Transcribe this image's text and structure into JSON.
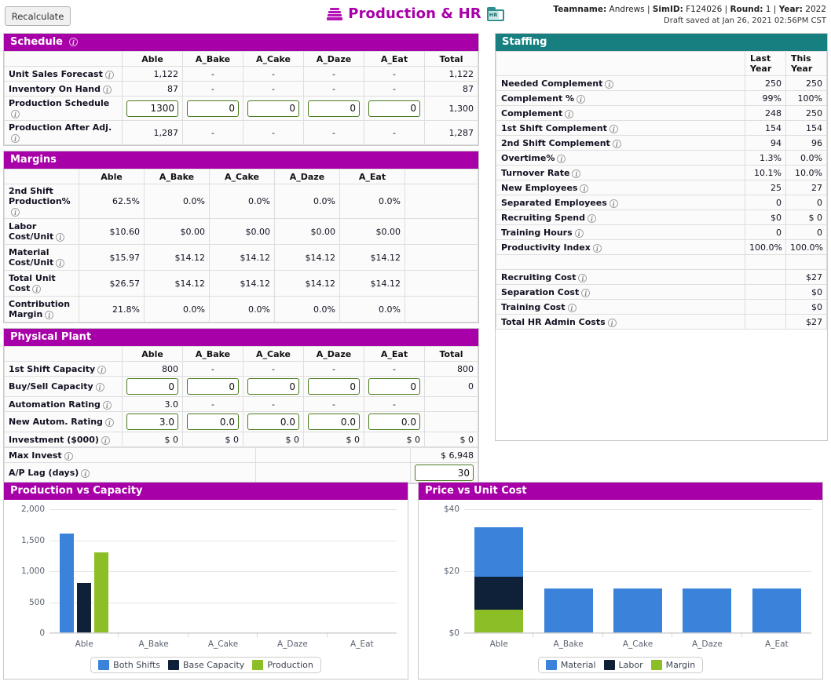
{
  "toolbar": {
    "recalculate_label": "Recalculate",
    "page_title": "Production & HR",
    "stack_icon": "stack-icon",
    "hr_folder_icon": "hr-folder-icon",
    "hr_folder_label": "HR"
  },
  "header_info": {
    "teamname_label": "Teamname:",
    "teamname_value": "Andrews",
    "simid_label": "SimID:",
    "simid_value": "F124026",
    "round_label": "Round:",
    "round_value": "1",
    "year_label": "Year:",
    "year_value": "2022",
    "draft_saved": "Draft saved at Jan 26, 2021 02:56PM CST"
  },
  "schedule": {
    "title": "Schedule",
    "columns": [
      "",
      "Able",
      "A_Bake",
      "A_Cake",
      "A_Daze",
      "A_Eat",
      "Total"
    ],
    "rows": [
      {
        "label": "Unit Sales Forecast",
        "cells": [
          "1,122",
          "-",
          "-",
          "-",
          "-"
        ],
        "total": "1,122",
        "input": false
      },
      {
        "label": "Inventory On Hand",
        "cells": [
          "87",
          "-",
          "-",
          "-",
          "-"
        ],
        "total": "87",
        "input": false
      },
      {
        "label": "Production Schedule",
        "cells": [
          "1300",
          "0",
          "0",
          "0",
          "0"
        ],
        "total": "1,300",
        "input": true
      },
      {
        "label": "Production After Adj.",
        "cells": [
          "1,287",
          "-",
          "-",
          "-",
          "-"
        ],
        "total": "1,287",
        "input": false
      }
    ]
  },
  "margins": {
    "title": "Margins",
    "columns": [
      "",
      "Able",
      "A_Bake",
      "A_Cake",
      "A_Daze",
      "A_Eat",
      ""
    ],
    "rows": [
      {
        "label": "2nd Shift Production%",
        "cells": [
          "62.5%",
          "0.0%",
          "0.0%",
          "0.0%",
          "0.0%"
        ]
      },
      {
        "label": "Labor Cost/Unit",
        "cells": [
          "$10.60",
          "$0.00",
          "$0.00",
          "$0.00",
          "$0.00"
        ]
      },
      {
        "label": "Material Cost/Unit",
        "cells": [
          "$15.97",
          "$14.12",
          "$14.12",
          "$14.12",
          "$14.12"
        ]
      },
      {
        "label": "Total Unit Cost",
        "cells": [
          "$26.57",
          "$14.12",
          "$14.12",
          "$14.12",
          "$14.12"
        ]
      },
      {
        "label": "Contribution Margin",
        "cells": [
          "21.8%",
          "0.0%",
          "0.0%",
          "0.0%",
          "0.0%"
        ]
      }
    ]
  },
  "physical_plant": {
    "title": "Physical Plant",
    "columns": [
      "",
      "Able",
      "A_Bake",
      "A_Cake",
      "A_Daze",
      "A_Eat",
      "Total"
    ],
    "rows": [
      {
        "label": "1st Shift Capacity",
        "cells": [
          "800",
          "-",
          "-",
          "-",
          "-"
        ],
        "total": "800",
        "input": false
      },
      {
        "label": "Buy/Sell Capacity",
        "cells": [
          "0",
          "0",
          "0",
          "0",
          "0"
        ],
        "total": "0",
        "input": true
      },
      {
        "label": "Automation Rating",
        "cells": [
          "3.0",
          "-",
          "-",
          "-",
          "-"
        ],
        "total": "",
        "input": false
      },
      {
        "label": "New Autom. Rating",
        "cells": [
          "3.0",
          "0.0",
          "0.0",
          "0.0",
          "0.0"
        ],
        "total": "",
        "input": true
      },
      {
        "label": "Investment ($000)",
        "cells": [
          "$ 0",
          "$ 0",
          "$ 0",
          "$ 0",
          "$ 0"
        ],
        "total": "$ 0",
        "input": false
      }
    ],
    "max_invest_label": "Max Invest",
    "max_invest_value": "$ 6,948",
    "ap_lag_label": "A/P Lag (days)",
    "ap_lag_value": "30"
  },
  "staffing": {
    "title": "Staffing",
    "col_last_year": "Last\nYear",
    "col_last_year_l1": "Last",
    "col_last_year_l2": "Year",
    "col_this_year_l1": "This",
    "col_this_year_l2": "Year",
    "rows": [
      {
        "label": "Needed Complement",
        "last": "250",
        "this": "250"
      },
      {
        "label": "Complement %",
        "last": "99%",
        "this": "100%"
      },
      {
        "label": "Complement",
        "last": "248",
        "this": "250"
      },
      {
        "label": "1st Shift Complement",
        "last": "154",
        "this": "154"
      },
      {
        "label": "2nd Shift Complement",
        "last": "94",
        "this": "96"
      },
      {
        "label": "Overtime%",
        "last": "1.3%",
        "this": "0.0%"
      },
      {
        "label": "Turnover Rate",
        "last": "10.1%",
        "this": "10.0%"
      },
      {
        "label": "New Employees",
        "last": "25",
        "this": "27"
      },
      {
        "label": "Separated Employees",
        "last": "0",
        "this": "0"
      },
      {
        "label": "Recruiting Spend",
        "last": "$0",
        "this": "$ 0"
      },
      {
        "label": "Training Hours",
        "last": "0",
        "this": "0"
      },
      {
        "label": "Productivity Index",
        "last": "100.0%",
        "this": "100.0%"
      }
    ],
    "cost_rows": [
      {
        "label": "Recruiting Cost",
        "last": "",
        "this": "$27"
      },
      {
        "label": "Separation Cost",
        "last": "",
        "this": "$0"
      },
      {
        "label": "Training Cost",
        "last": "",
        "this": "$0"
      },
      {
        "label": "Total HR Admin Costs",
        "last": "",
        "this": "$27"
      }
    ]
  },
  "colors": {
    "magenta": "#a800a8",
    "teal": "#177f7f",
    "blue": "#3b82db",
    "navy": "#0f2039",
    "green": "#8cbe26"
  },
  "chart_data": [
    {
      "type": "bar",
      "title": "Production vs Capacity",
      "categories": [
        "Able",
        "A_Bake",
        "A_Cake",
        "A_Daze",
        "A_Eat"
      ],
      "series": [
        {
          "name": "Both Shifts",
          "color": "#3b82db",
          "values": [
            1600,
            0,
            0,
            0,
            0
          ]
        },
        {
          "name": "Base Capacity",
          "color": "#0f2039",
          "values": [
            800,
            0,
            0,
            0,
            0
          ]
        },
        {
          "name": "Production",
          "color": "#8cbe26",
          "values": [
            1287,
            0,
            0,
            0,
            0
          ]
        }
      ],
      "yticks": [
        "2,000",
        "1,500",
        "1,000",
        "500",
        "0"
      ],
      "ylim": [
        0,
        2000
      ],
      "xlabel": "",
      "ylabel": "",
      "grid": true,
      "legend_position": "bottom"
    },
    {
      "type": "bar",
      "stacked": true,
      "title": "Price vs Unit Cost",
      "categories": [
        "Able",
        "A_Bake",
        "A_Cake",
        "A_Daze",
        "A_Eat"
      ],
      "series": [
        {
          "name": "Material",
          "color": "#3b82db",
          "values": [
            15.97,
            14.12,
            14.12,
            14.12,
            14.12
          ]
        },
        {
          "name": "Labor",
          "color": "#0f2039",
          "values": [
            10.6,
            0,
            0,
            0,
            0
          ]
        },
        {
          "name": "Margin",
          "color": "#8cbe26",
          "values": [
            7.41,
            0,
            0,
            0,
            0
          ]
        }
      ],
      "yticks": [
        "$40",
        "$20",
        "$0"
      ],
      "ylim": [
        0,
        40
      ],
      "xlabel": "",
      "ylabel": "",
      "grid": true,
      "legend_position": "bottom"
    }
  ]
}
